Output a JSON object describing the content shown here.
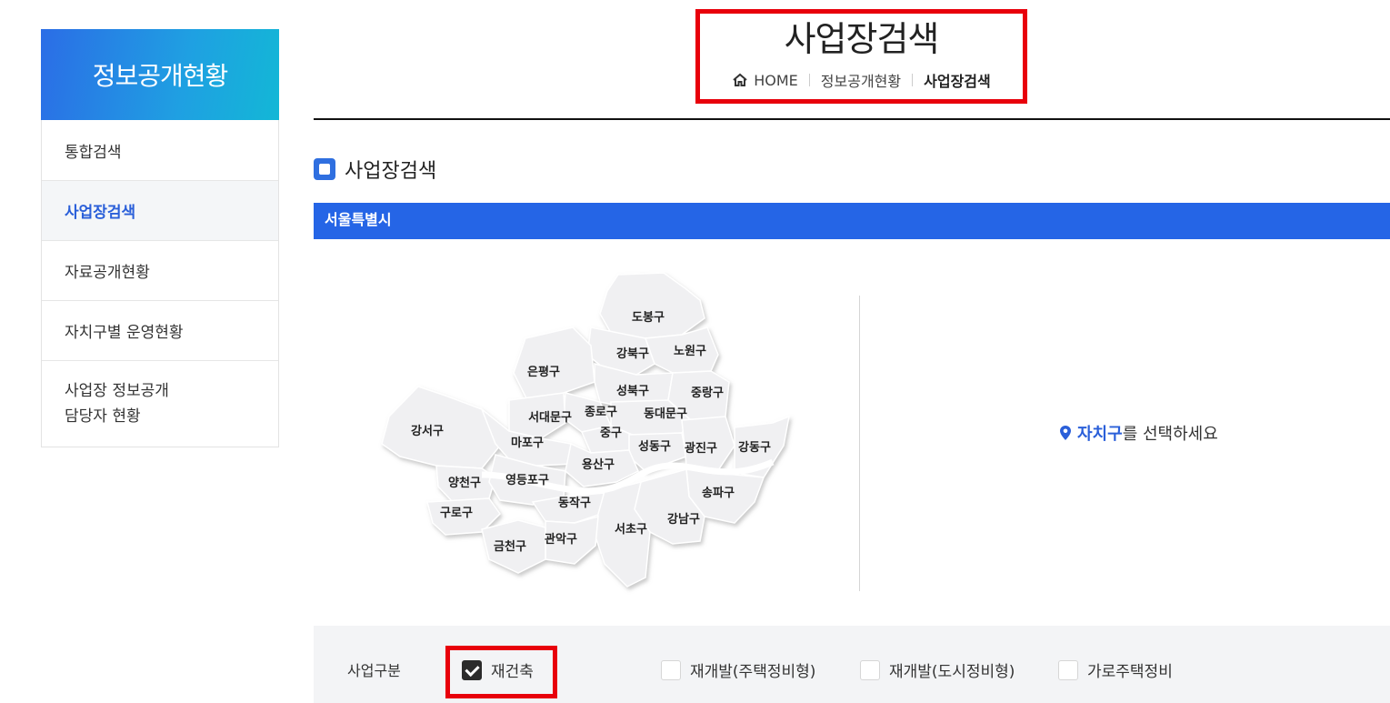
{
  "sidebar": {
    "title": "정보공개현황",
    "items": [
      {
        "label": "통합검색"
      },
      {
        "label": "사업장검색",
        "active": true
      },
      {
        "label": "자료공개현황"
      },
      {
        "label": "자치구별 운영현황"
      },
      {
        "label_line1": "사업장 정보공개",
        "label_line2": "담당자 현황"
      }
    ]
  },
  "header": {
    "title": "사업장검색",
    "breadcrumb": [
      "HOME",
      "정보공개현황",
      "사업장검색"
    ]
  },
  "section": {
    "title": "사업장검색",
    "region": "서울특별시"
  },
  "map": {
    "districts": [
      "도봉구",
      "강북구",
      "노원구",
      "은평구",
      "성북구",
      "중랑구",
      "종로구",
      "서대문구",
      "동대문구",
      "강서구",
      "중구",
      "마포구",
      "성동구",
      "광진구",
      "강동구",
      "용산구",
      "양천구",
      "영등포구",
      "송파구",
      "동작구",
      "구로구",
      "강남구",
      "서초구",
      "관악구",
      "금천구"
    ]
  },
  "prompt": {
    "accent": "자치구",
    "rest": "를 선택하세요"
  },
  "filter": {
    "label": "사업구분",
    "options": [
      {
        "label": "재건축",
        "checked": true
      },
      {
        "label": "재개발(주택정비형)",
        "checked": false
      },
      {
        "label": "재개발(도시정비형)",
        "checked": false
      },
      {
        "label": "가로주택정비",
        "checked": false
      }
    ]
  },
  "colors": {
    "brand_blue": "#2565e6",
    "highlight_red": "#e8000b"
  }
}
